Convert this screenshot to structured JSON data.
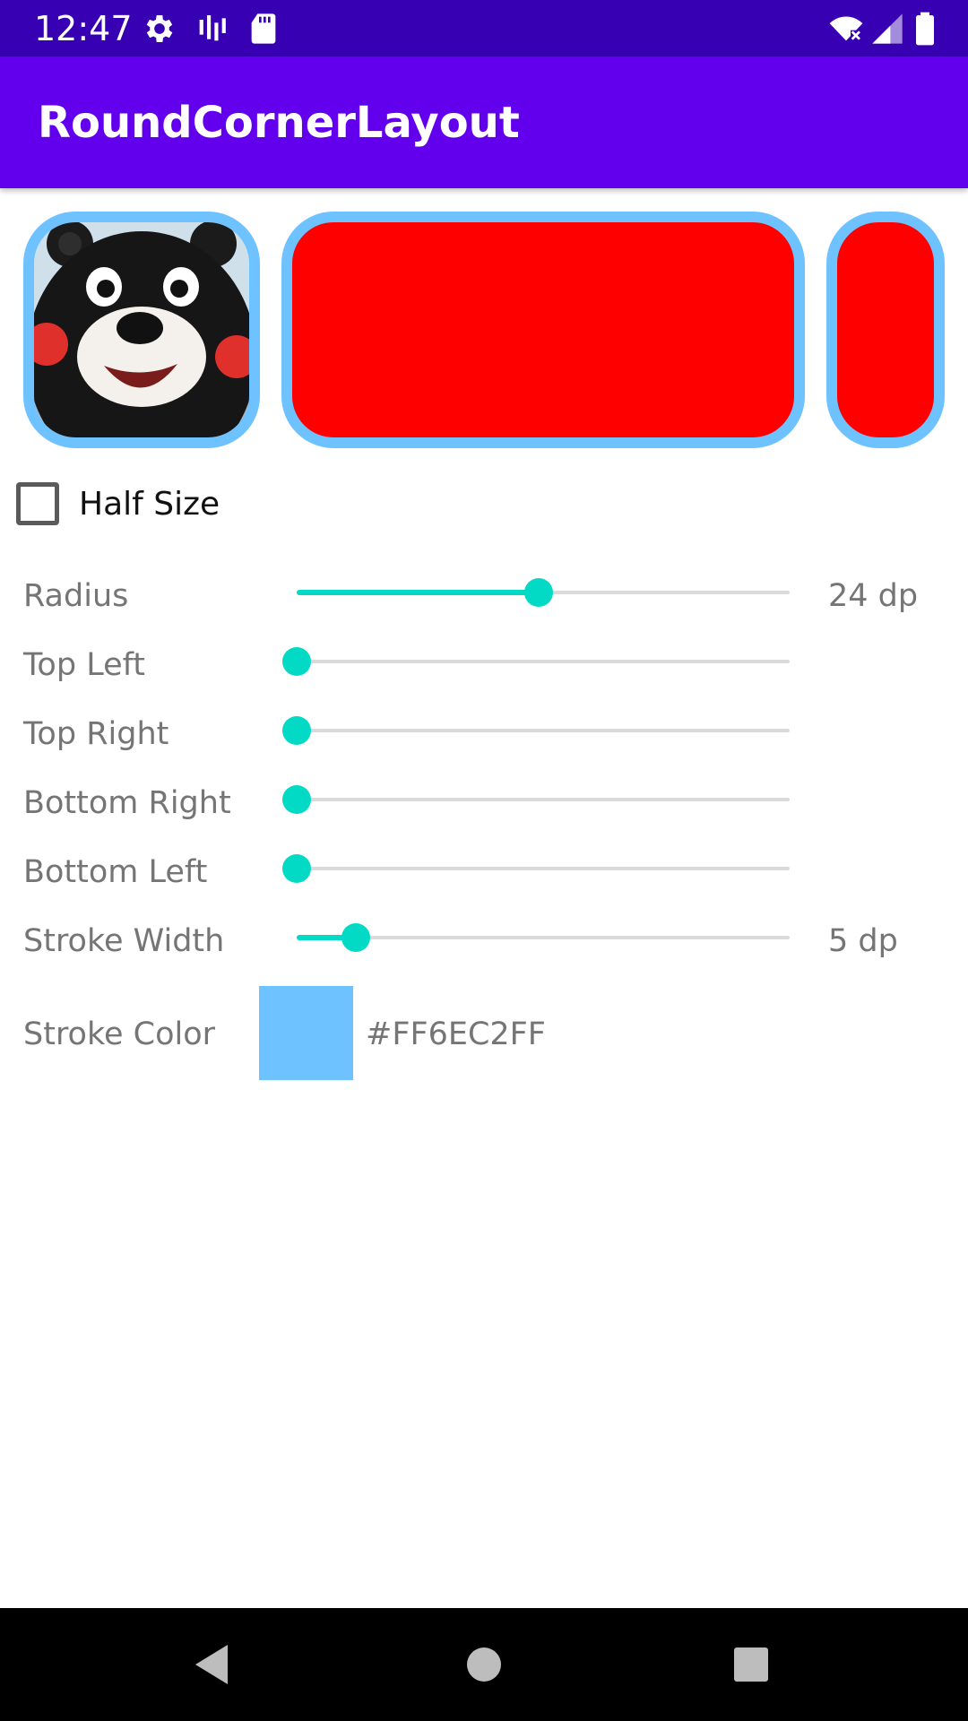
{
  "status_bar": {
    "time": "12:47",
    "icons": [
      "settings-icon",
      "signal-bars-icon",
      "sd-card-icon",
      "wifi-icon",
      "cell-signal-icon",
      "battery-icon"
    ]
  },
  "app_bar": {
    "title": "RoundCornerLayout"
  },
  "previews": {
    "image_icon": "bear-mascot-image",
    "fill_color": "#FF0000",
    "stroke_color": "#6EC2FF"
  },
  "half_size": {
    "label": "Half Size",
    "checked": false
  },
  "settings": {
    "radius": {
      "label": "Radius",
      "value": "24 dp",
      "level": 0.49
    },
    "top_left": {
      "label": "Top Left",
      "level": 0.0
    },
    "top_right": {
      "label": "Top Right",
      "level": 0.0
    },
    "bottom_right": {
      "label": "Bottom Right",
      "level": 0.0
    },
    "bottom_left": {
      "label": "Bottom Left",
      "level": 0.0
    },
    "stroke_width": {
      "label": "Stroke Width",
      "value": "5 dp",
      "level": 0.12
    },
    "stroke_color": {
      "label": "Stroke Color",
      "value": "#FF6EC2FF"
    }
  },
  "colors": {
    "accent": "#03DAC5",
    "primary": "#6200EE",
    "primary_dark": "#3700B3"
  },
  "nav_bar": {
    "icons": [
      "back-icon",
      "home-icon",
      "recents-icon"
    ]
  }
}
